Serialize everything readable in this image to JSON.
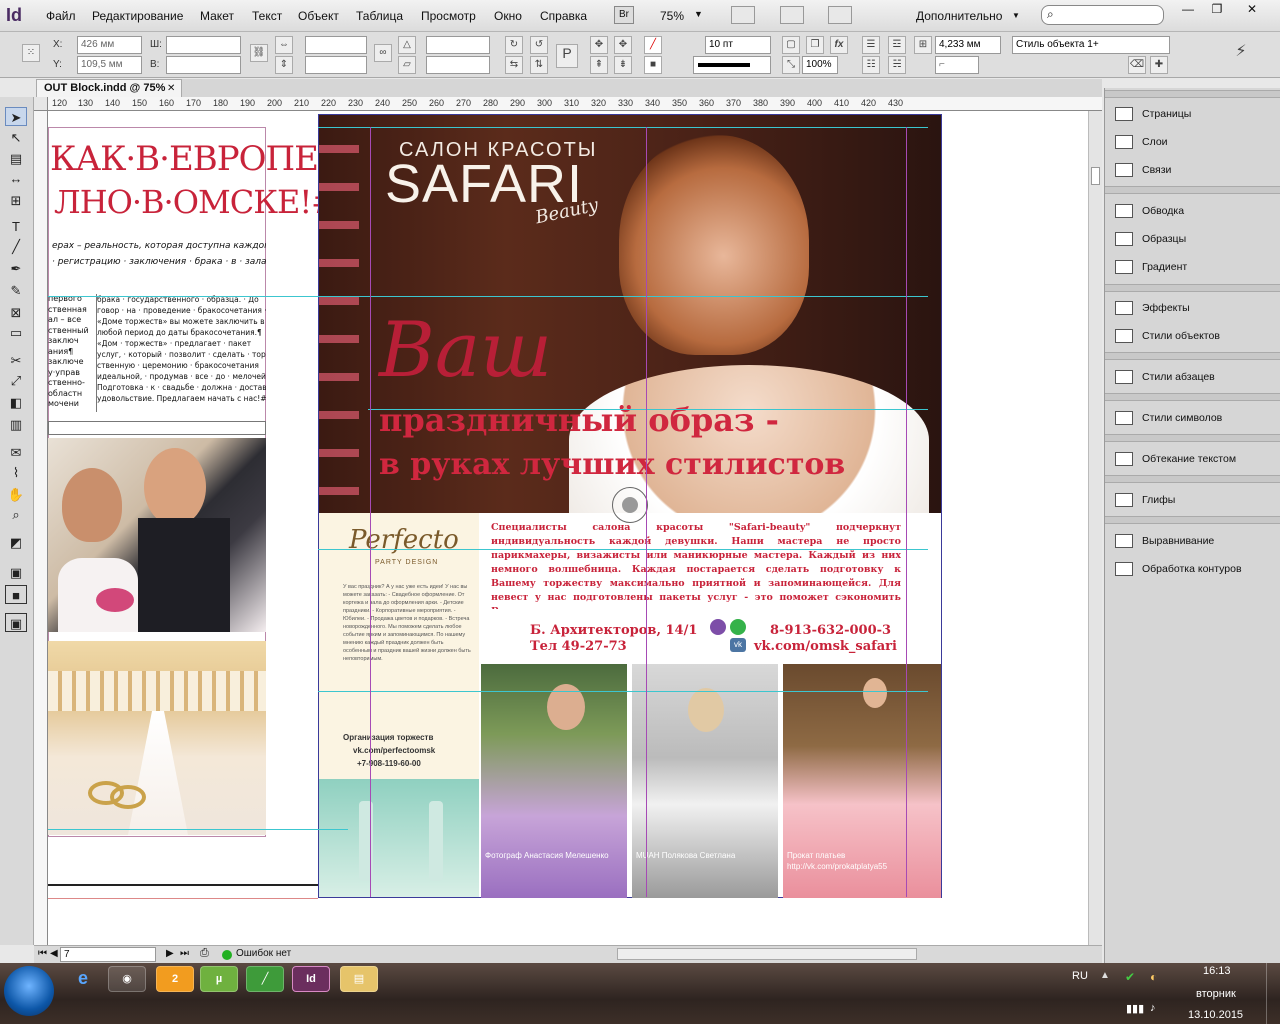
{
  "app": {
    "logo": "Id"
  },
  "menu": [
    "Файл",
    "Редактирование",
    "Макет",
    "Текст",
    "Объект",
    "Таблица",
    "Просмотр",
    "Окно",
    "Справка"
  ],
  "menubar": {
    "bridge": "Br",
    "zoom": "75%",
    "workspace": "Дополнительно",
    "win_min": "—",
    "win_max": "❐",
    "win_close": "✕"
  },
  "control": {
    "x_label": "X:",
    "x_value": "426 мм",
    "y_label": "Y:",
    "y_value": "109,5 мм",
    "w_label": "Ш:",
    "h_label": "В:",
    "stroke_weight": "10 пт",
    "size_value": "4,233 мм",
    "object_style": "Стиль объекта 1+",
    "scale": "100%"
  },
  "document": {
    "tab_title": "OUT Block.indd @ 75%",
    "tab_close": "✕"
  },
  "ruler_top": [
    "120",
    "130",
    "140",
    "150",
    "160",
    "170",
    "180",
    "190",
    "200",
    "210",
    "220",
    "230",
    "240",
    "250",
    "260",
    "270",
    "280",
    "290",
    "300",
    "310",
    "320",
    "330",
    "340",
    "350",
    "360",
    "370",
    "380",
    "390",
    "400",
    "410",
    "420",
    "430"
  ],
  "status": {
    "page": "7",
    "preflight": "Ошибок нет"
  },
  "panels": {
    "g1": [
      "Страницы",
      "Слои",
      "Связи"
    ],
    "g2": [
      "Обводка",
      "Образцы",
      "Градиент"
    ],
    "g3": [
      "Эффекты",
      "Стили объектов"
    ],
    "g4": [
      "Стили абзацев"
    ],
    "g5": [
      "Стили символов"
    ],
    "g6": [
      "Обтекание текстом"
    ],
    "g7": [
      "Глифы"
    ],
    "g8": [
      "Выравнивание",
      "Обработка контуров"
    ]
  },
  "left_page": {
    "headline1": "КАК·В·ЕВРОПЕ¶",
    "headline2": "ЛНО·В·ОМСКЕ!#",
    "intro1": "ерах – реальность, которая доступна каждому",
    "intro2": "· регистрацию · заключения · брака · в · залах · на",
    "col1": [
      "первого",
      "ственная",
      "ал – все",
      "ственный",
      "заключ",
      "ания¶",
      "заключе",
      "у·управ",
      "ственно-",
      "областн",
      "мочени"
    ],
    "col2": [
      "брака · государственного · образца. · До",
      "говор · на · проведение · бракосочетания · в",
      "«Доме торжеств» вы можете заключить в",
      "любой период до даты бракосочетания.¶",
      "«Дом · торжеств» · предлагает · пакет",
      "услуг, · который · позволит · сделать · торже",
      "ственную · церемонию · бракосочетания",
      "идеальной, · продумав · все · до · мелочей.",
      "Подготовка · к · свадьбе · должна · доставлять",
      "удовольствие. Предлагаем начать с нас!#"
    ]
  },
  "ad": {
    "salon": "САЛОН КРАСОТЫ",
    "brand": "SAFARI",
    "beauty": "Beauty",
    "script": "Ваш",
    "line1": "праздничный образ -",
    "line2": "в руках лучших стилистов",
    "desc": "Специалисты салона красоты \"Safari-beauty\" подчеркнут индивидуальность каждой девушки. Наши мастера не просто парикмахеры, визажисты или маникюрные мастера. Каждый из них немного волшебница. Каждая постарается сделать подготовку к Вашему торжеству максимально приятной и запоминающейся. Для невест у нас подготовлены пакеты услуг - это поможет сэкономить Ваши деньги.",
    "address": "Б. Архитекторов, 14/1",
    "tel": "Тел 49-27-73",
    "phone": "8-913-632-000-3",
    "vk": "vk.com/omsk_safari",
    "perfecto": "Perfecto",
    "perfecto_sub": "PARTY DESIGN",
    "perfecto_text": "У вас праздник? А у нас уже есть идеи! У нас вы можете заказать: - Свадебное оформление. От кортежа и зала до оформления арки. - Детские праздники. - Корпоративные мероприятия. - Юбилеи. - Продажа цветов и подарков. - Встреча новорожденного. Мы поможем сделать любое событие ярким и запоминающимся. По нашему мнению каждый праздник должен быть особенным и праздник вашей жизни должен быть неповторимым.",
    "perfecto_org": "Организация торжеств",
    "perfecto_vk": "vk.com/perfectoomsk",
    "perfecto_tel": "+7-908-119-60-00",
    "cap1": "Фотограф Анастасия Мелешенко",
    "cap2": "MUAH Полякова Светлана",
    "cap3": "Прокат платьев http://vk.com/prokatplatya55"
  },
  "taskbar": {
    "lang": "RU",
    "time": "16:13",
    "day": "вторник",
    "date": "13.10.2015",
    "badge": "2",
    "id": "Id"
  }
}
